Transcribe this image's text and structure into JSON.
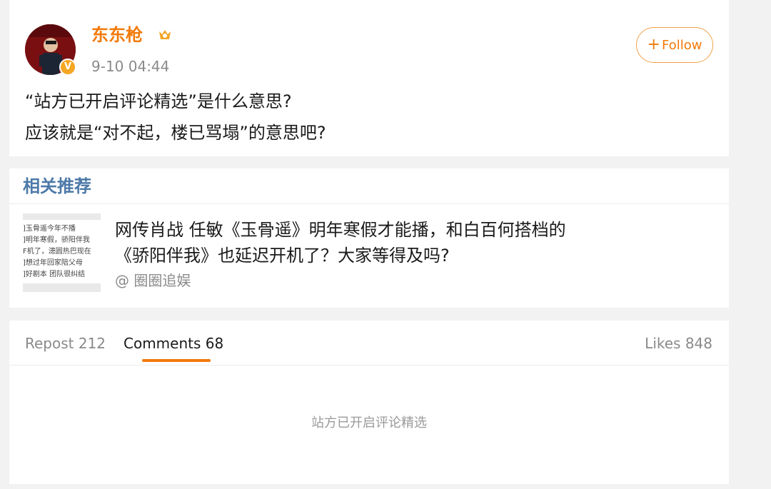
{
  "post": {
    "username": "东东枪",
    "timestamp": "9-10 04:44",
    "follow_label": "Follow",
    "follow_plus": "+",
    "text_line1": "“站方已开启评论精选”是什么意思?",
    "text_line2": "应该就是“对不起，楼已骂塌”的意思吧?"
  },
  "recommend": {
    "section_title": "相关推荐",
    "title_line1": "网传肖战 任敏《玉骨遥》明年寒假才能播，和白百何搭档的",
    "title_line2": "《骄阳伴我》也延迟开机了？大家等得及吗?",
    "source": "@ 圈圈追娱",
    "thumbnail_lines": [
      "]玉骨遥今年不播",
      "]明年寒假，骄阳伴我",
      "F机了，漶圆热巴现在",
      "]想过年回家陪父母",
      "]好剧本 团队很纠结"
    ]
  },
  "tabs": {
    "repost": "Repost 212",
    "comments": "Comments 68",
    "likes": "Likes 848"
  },
  "comments": {
    "notice": "站方已开启评论精选"
  },
  "colors": {
    "accent": "#f27a0a",
    "link_blue": "#4d79a8",
    "muted": "#8a8a8a",
    "background": "#f2f2f2"
  }
}
